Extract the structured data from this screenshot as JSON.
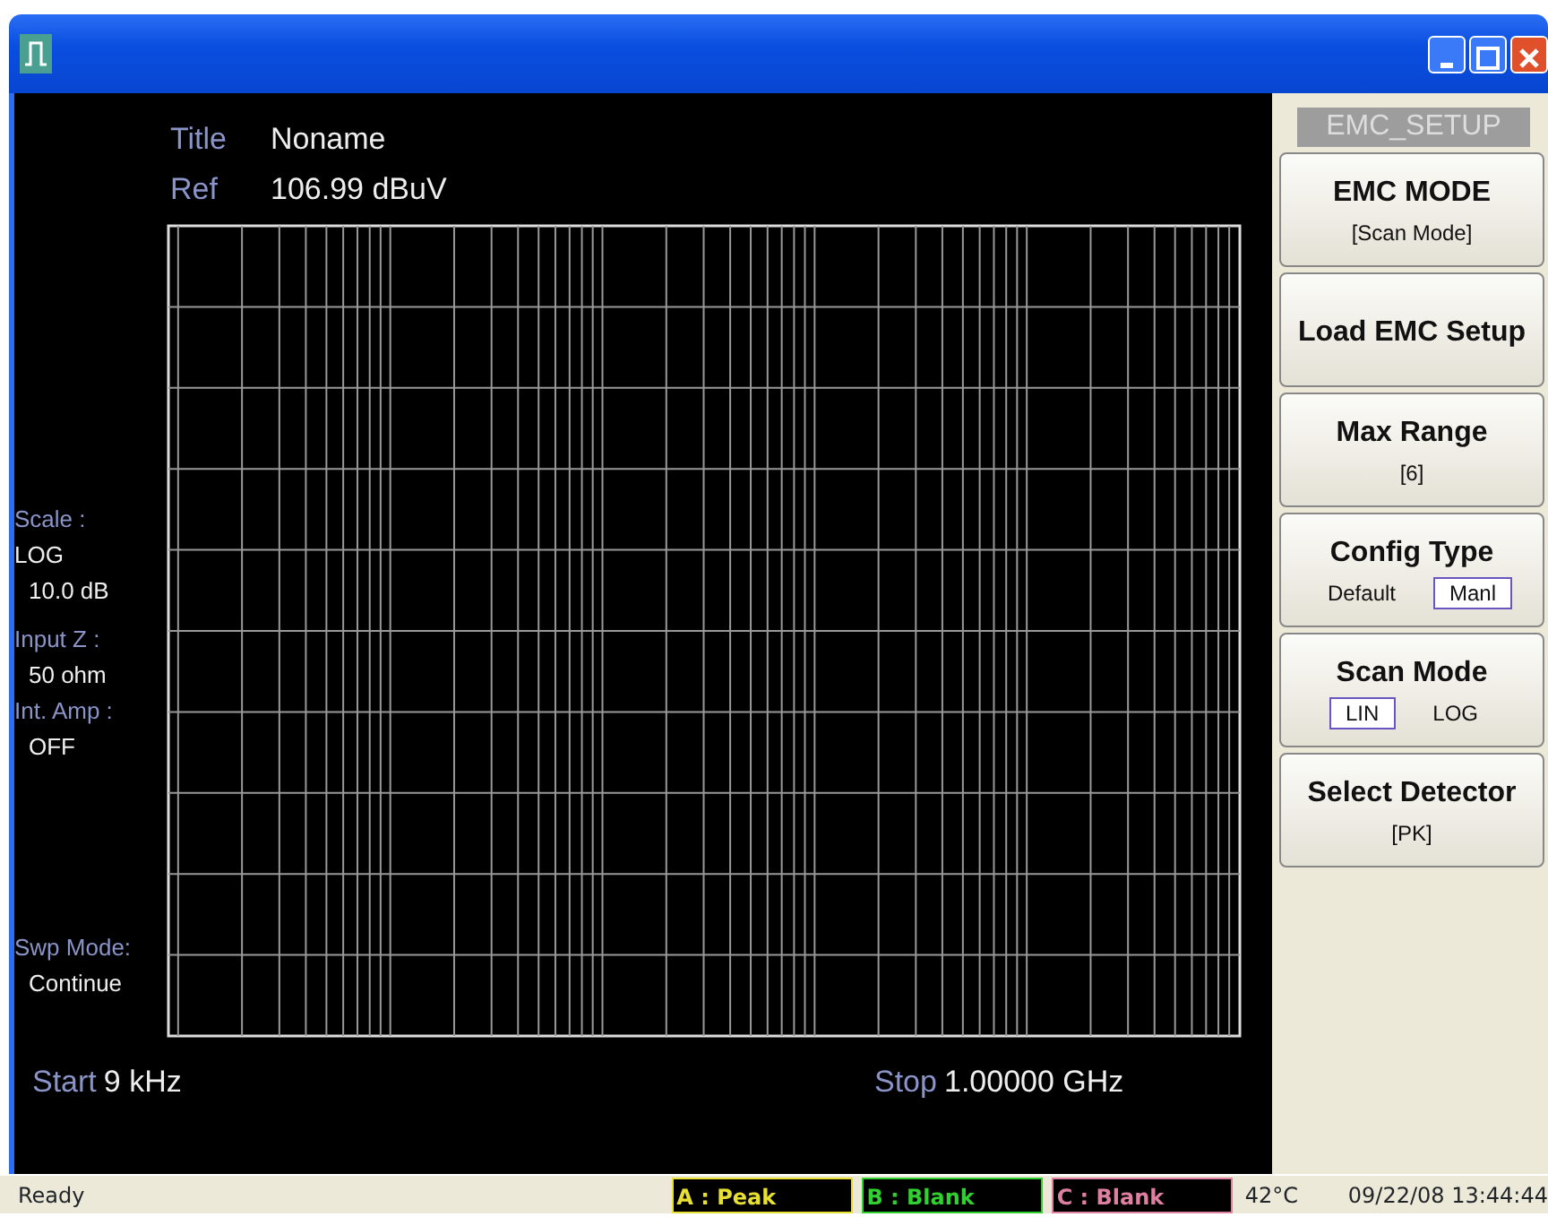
{
  "header": [
    {
      "label": "Title",
      "value": "Noname"
    },
    {
      "label": "Ref",
      "value": "106.99 dBuV"
    }
  ],
  "params": [
    {
      "label": "Scale :",
      "values": [
        "LOG",
        "10.0 dB"
      ]
    },
    {
      "label": "Input Z :",
      "values": [
        "50 ohm"
      ]
    },
    {
      "label": "Int. Amp :",
      "values": [
        "OFF"
      ]
    },
    {
      "label": "Swp Mode:",
      "values": [
        "Continue"
      ]
    }
  ],
  "start": {
    "label": "Start",
    "value": "9 kHz"
  },
  "stop": {
    "label": "Stop",
    "value": "1.00000 GHz"
  },
  "menu": {
    "title": "EMC_SETUP",
    "keys": [
      {
        "kind": "value",
        "label": "EMC MODE",
        "value": "[Scan Mode]"
      },
      {
        "kind": "plain",
        "label": "Load EMC Setup"
      },
      {
        "kind": "value",
        "label": "Max Range",
        "value": "[6]"
      },
      {
        "kind": "choice",
        "label": "Config Type",
        "options": [
          {
            "label": "Default",
            "selected": false
          },
          {
            "label": "Manl",
            "selected": true
          }
        ]
      },
      {
        "kind": "choice",
        "label": "Scan Mode",
        "options": [
          {
            "label": "LIN",
            "selected": true
          },
          {
            "label": "LOG",
            "selected": false
          }
        ]
      },
      {
        "kind": "value",
        "label": "Select Detector",
        "value": "[PK]"
      }
    ]
  },
  "status_bar": {
    "message": "Ready",
    "traces": [
      {
        "text": "A : Peak",
        "color": "#e8e030"
      },
      {
        "text": "B : Blank",
        "color": "#30d030"
      },
      {
        "text": "C : Blank",
        "color": "#e080a0"
      }
    ],
    "temperature": "42°C",
    "datetime": "09/22/08 13:44:44"
  }
}
